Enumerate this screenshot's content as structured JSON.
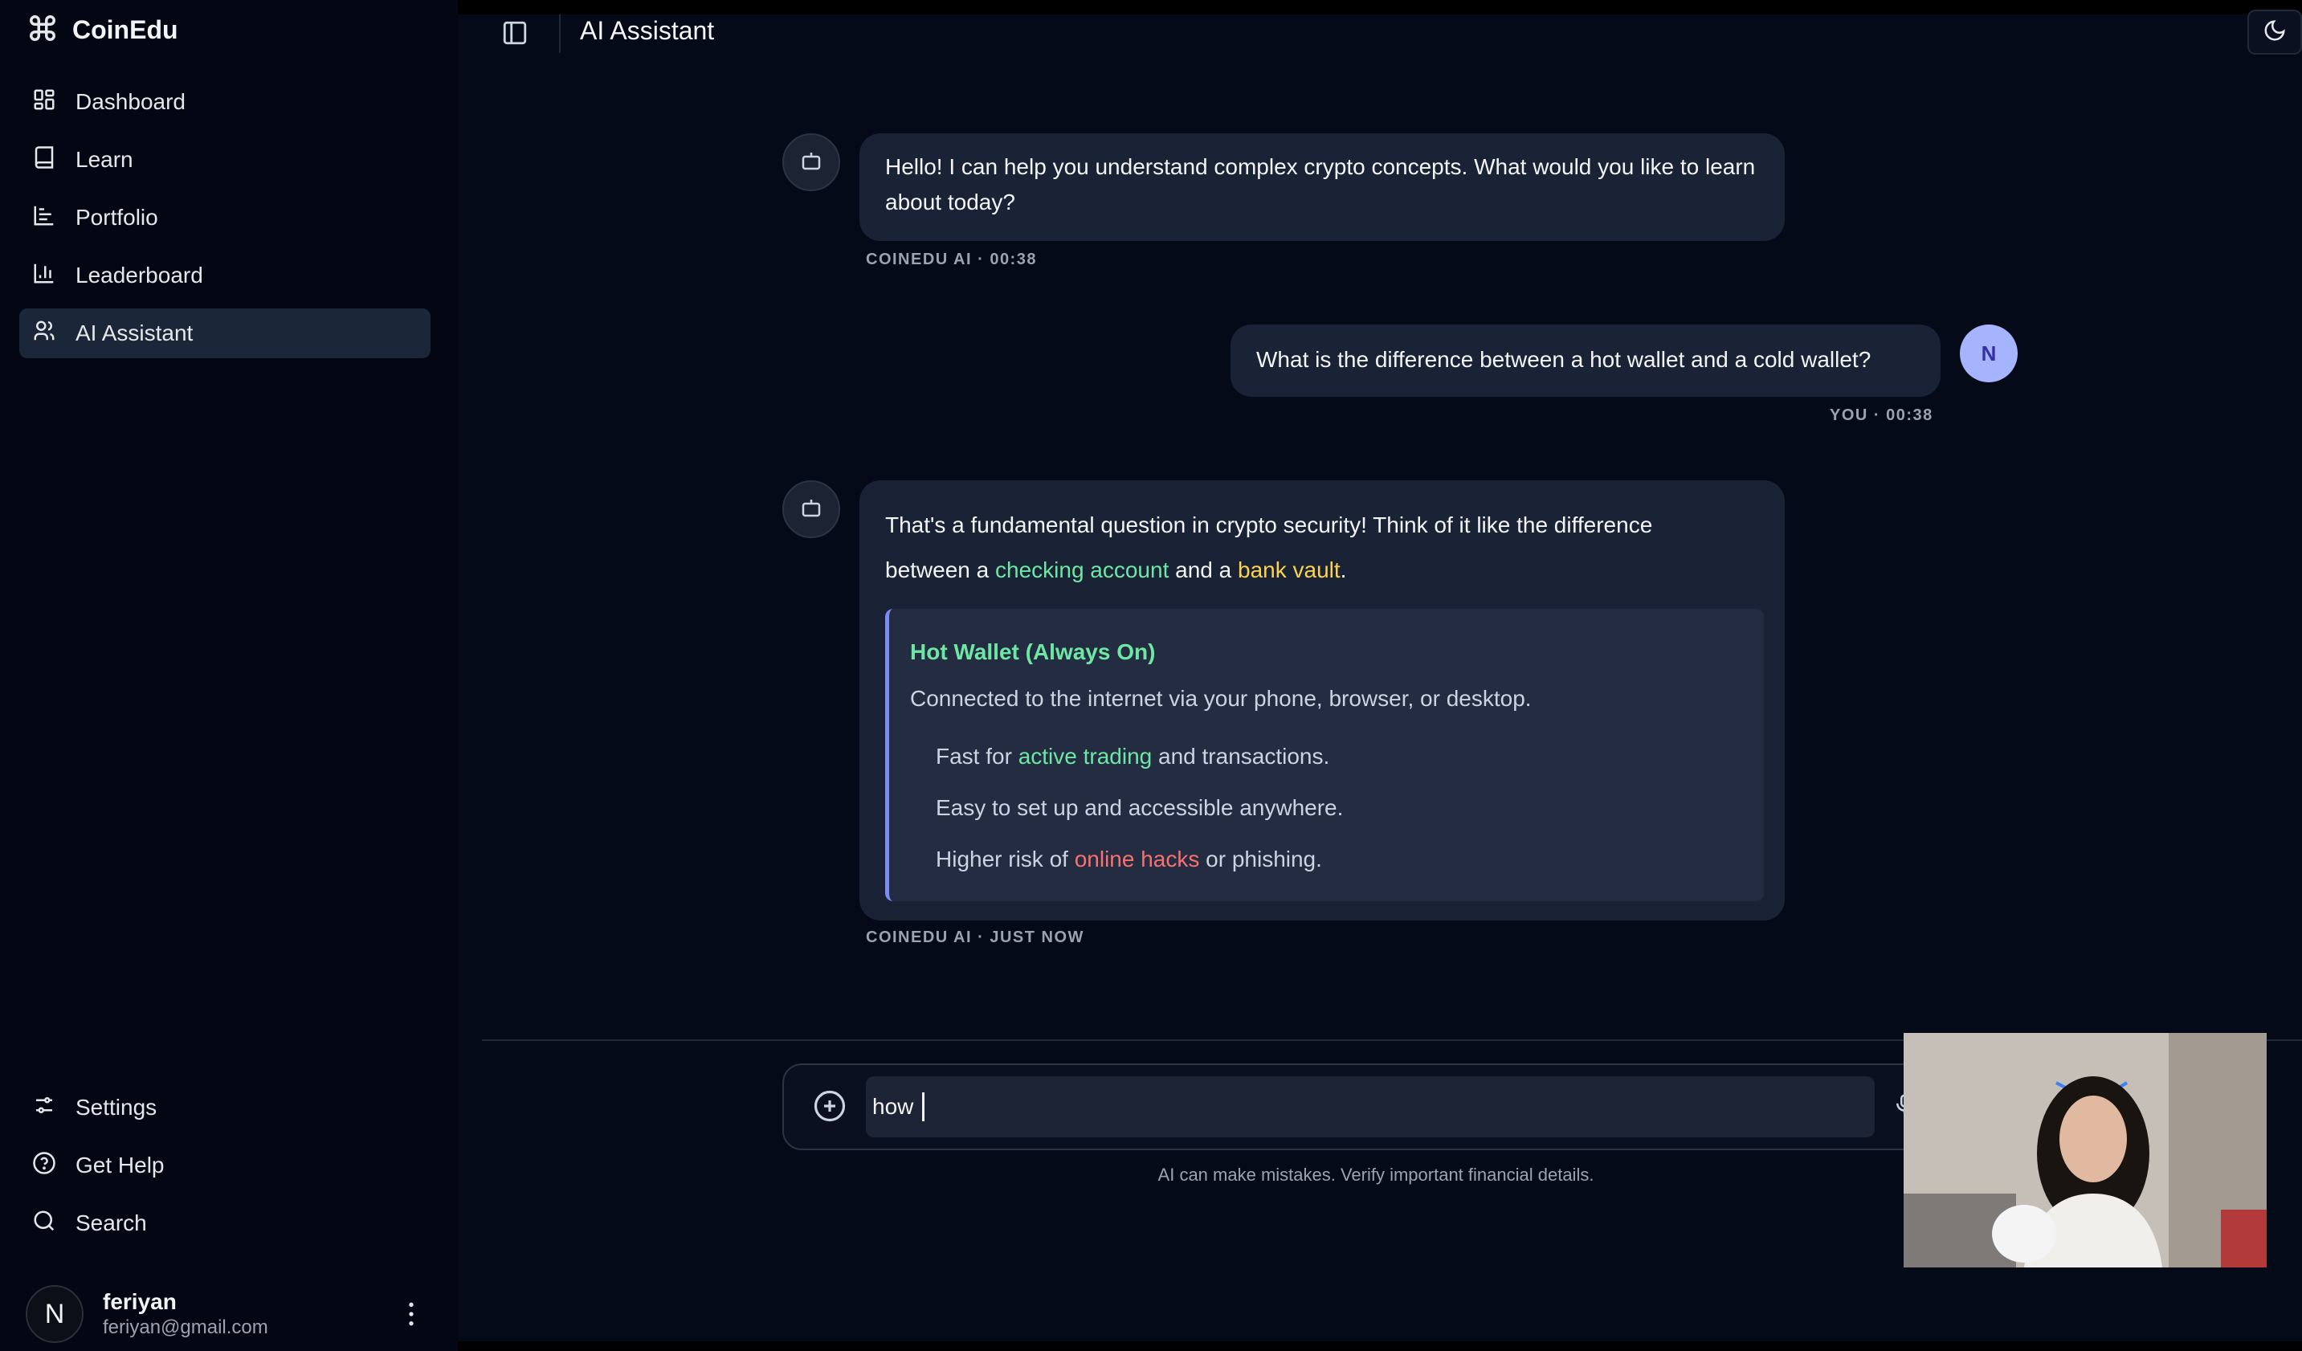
{
  "app": {
    "name": "CoinEdu"
  },
  "sidebar": {
    "nav": [
      {
        "label": "Dashboard",
        "icon": "grid-icon"
      },
      {
        "label": "Learn",
        "icon": "book-icon"
      },
      {
        "label": "Portfolio",
        "icon": "chart-line-icon"
      },
      {
        "label": "Leaderboard",
        "icon": "bar-chart-icon"
      },
      {
        "label": "AI Assistant",
        "icon": "users-icon",
        "active": true
      }
    ],
    "bottom": [
      {
        "label": "Settings",
        "icon": "sliders-icon"
      },
      {
        "label": "Get Help",
        "icon": "help-circle-icon"
      },
      {
        "label": "Search",
        "icon": "search-icon"
      }
    ],
    "user": {
      "initial": "N",
      "name": "feriyan",
      "email": "feriyan@gmail.com"
    }
  },
  "header": {
    "title": "AI Assistant"
  },
  "chat": {
    "messages": [
      {
        "sender": "bot",
        "text": "Hello! I can help you understand complex crypto concepts. What would you like to learn about today?",
        "meta": "COINEDU AI · 00:38"
      },
      {
        "sender": "user",
        "avatar": "N",
        "text": "What is the difference between a hot wallet and a cold wallet?",
        "meta": "YOU · 00:38"
      },
      {
        "sender": "bot",
        "intro_1": "That's a fundamental question in crypto security! Think of it like the difference",
        "intro_2_before": "between a ",
        "hl_checking": "checking account",
        "intro_2_mid": " and a ",
        "hl_vault": "bank vault",
        "intro_2_end": ".",
        "card": {
          "title": "Hot Wallet (Always On)",
          "desc": "Connected to the internet via your phone, browser, or desktop.",
          "li1_before": "Fast for ",
          "li1_hl": "active trading",
          "li1_after": " and transactions.",
          "li2": "Easy to set up and accessible anywhere.",
          "li3_before": "Higher risk of ",
          "li3_hl": "online hacks",
          "li3_after": " or phishing."
        },
        "meta": "COINEDU AI · JUST NOW"
      }
    ]
  },
  "composer": {
    "value": "how",
    "disclaimer": "AI can make mistakes. Verify important financial details."
  },
  "colors": {
    "accent_green": "#6ee7a4",
    "accent_yellow": "#fcd34d",
    "accent_red": "#f87171",
    "user_avatar": "#a5b4fc"
  }
}
